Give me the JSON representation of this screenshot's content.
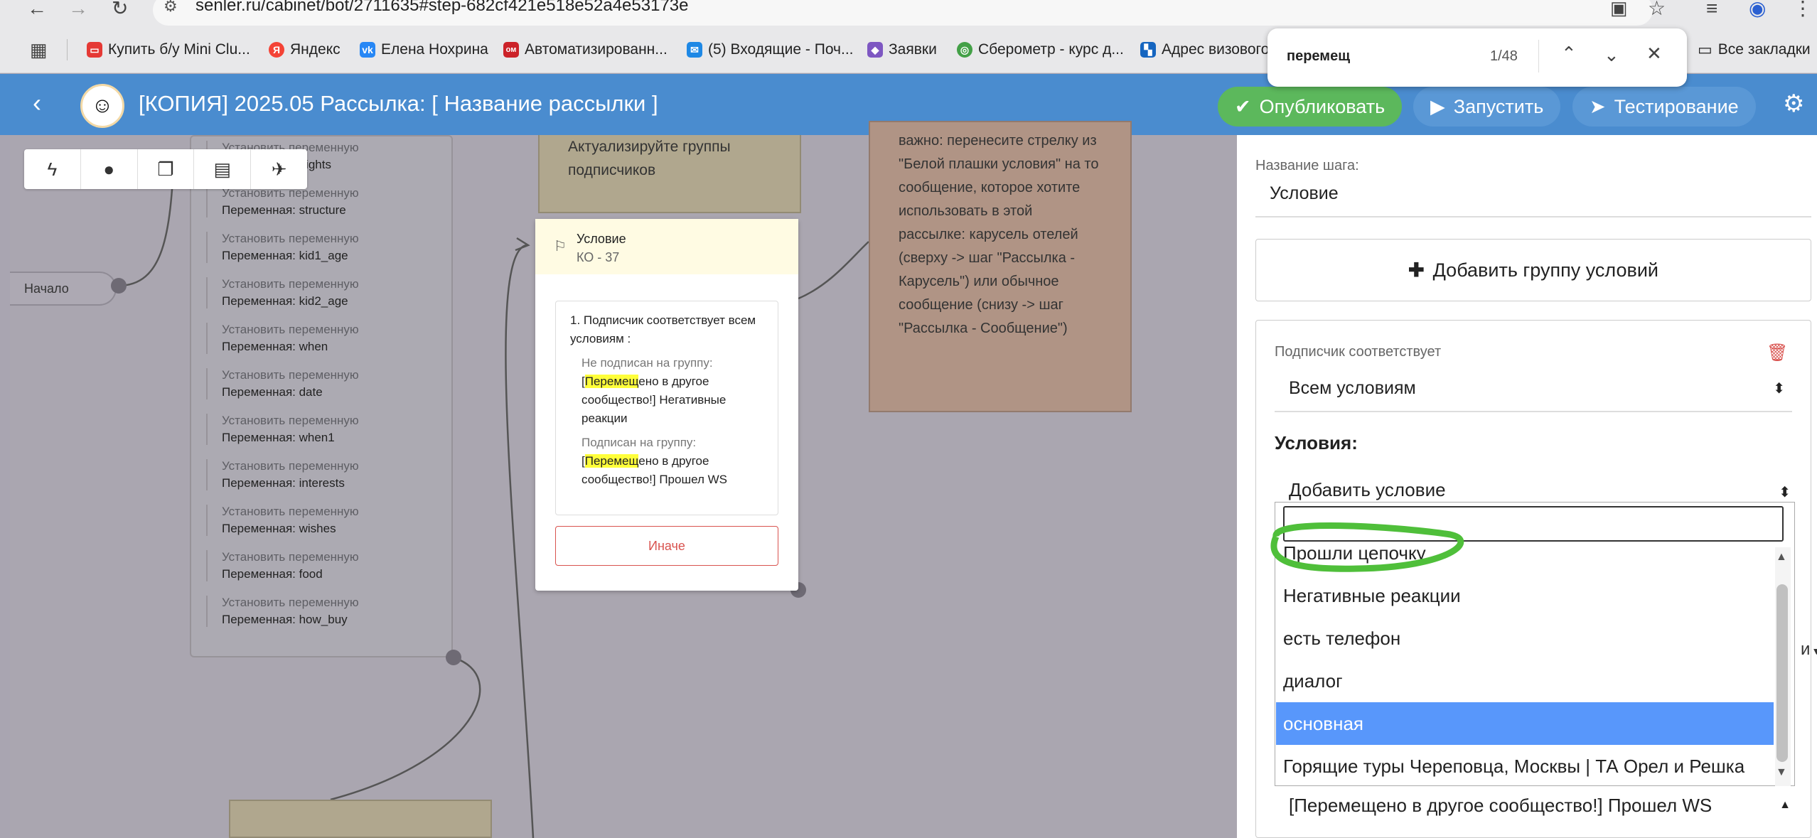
{
  "browser": {
    "url": "senler.ru/cabinet/bot/2711635#step-682cf421e518e52a4e53173e",
    "bookmarks": [
      {
        "label": "Купить б/у Mini Clu...",
        "color": "#e53935",
        "glyph": "▭"
      },
      {
        "label": "Яндекс",
        "color": "#f44336",
        "glyph": "Я"
      },
      {
        "label": "Елена Нохрина",
        "color": "#2787f5",
        "glyph": "vk"
      },
      {
        "label": "Автоматизированн...",
        "color": "#cc2229",
        "glyph": "ом"
      },
      {
        "label": "(5) Входящие - Поч...",
        "color": "#1e88e5",
        "glyph": "✉"
      },
      {
        "label": "Заявки",
        "color": "#7e57c2",
        "glyph": "◆"
      },
      {
        "label": "Сберометр - курс д...",
        "color": "#43a047",
        "glyph": "◎"
      },
      {
        "label": "Адрес визового",
        "color": "#1565c0",
        "glyph": "▚"
      }
    ],
    "all_bookmarks_label": "Все закладки",
    "find": {
      "query": "перемещ",
      "count": "1/48"
    }
  },
  "header": {
    "title": "[КОПИЯ] 2025.05 Рассылка: [ Название рассылки ]",
    "publish_label": "Опубликовать",
    "run_label": "Запустить",
    "test_label": "Тестирование",
    "colors": {
      "bar": "#4a8ccf",
      "publish": "#5cb85c"
    }
  },
  "canvas": {
    "start_label": "Начало",
    "variables": [
      {
        "top": "Установить переменную",
        "bottom": "Переменная: nights"
      },
      {
        "top": "Установить переменную",
        "bottom": "Переменная: structure"
      },
      {
        "top": "Установить переменную",
        "bottom": "Переменная: kid1_age"
      },
      {
        "top": "Установить переменную",
        "bottom": "Переменная: kid2_age"
      },
      {
        "top": "Установить переменную",
        "bottom": "Переменная: when"
      },
      {
        "top": "Установить переменную",
        "bottom": "Переменная: date"
      },
      {
        "top": "Установить переменную",
        "bottom": "Переменная: when1"
      },
      {
        "top": "Установить переменную",
        "bottom": "Переменная: interests"
      },
      {
        "top": "Установить переменную",
        "bottom": "Переменная: wishes"
      },
      {
        "top": "Установить переменную",
        "bottom": "Переменная: food"
      },
      {
        "top": "Установить переменную",
        "bottom": "Переменная: how_buy"
      }
    ],
    "note1": "Актуализируйте группы подписчиков",
    "note2": "важно: перенесите стрелку из \"Белой плашки условия\" на то сообщение, которое хотите использовать в этой рассылке: карусель отелей (сверху -> шаг \"Рассылка - Карусель\") или обычное сообщение (снизу -> шаг \"Рассылка - Сообщение\")",
    "condition": {
      "title": "Условие",
      "subtitle": "КО - 37",
      "header": "1. Подписчик соответствует всем условиям :",
      "cond1_label": "Не подписан на группу:",
      "cond1_open": "[",
      "cond1_hl": "Перемещ",
      "cond1_rest": "ено в другое сообщество!] Негативные реакции",
      "cond2_label": "Подписан на группу:",
      "cond2_open": "[",
      "cond2_hl": "Перемещ",
      "cond2_rest": "ено в другое сообщество!] Прошел WS",
      "else_label": "Иначе"
    }
  },
  "panel": {
    "step_name_label": "Название шага:",
    "step_name_value": "Условие",
    "add_group_label": "Добавить группу условий",
    "subscriber_label": "Подписчик соответствует",
    "match_value": "Всем условиям",
    "conditions_label": "Условия:",
    "add_condition_label": "Добавить условие",
    "options": [
      "Прошли цепочку",
      "Негативные реакции",
      "есть телефон",
      "диалог",
      "основная",
      "Горящие туры Череповца, Москвы | ТА Орел и Решка"
    ],
    "selected_index": 4,
    "bottom_value": "[Перемещено в другое сообщество!] Прошел WS",
    "cut_text": "и"
  }
}
